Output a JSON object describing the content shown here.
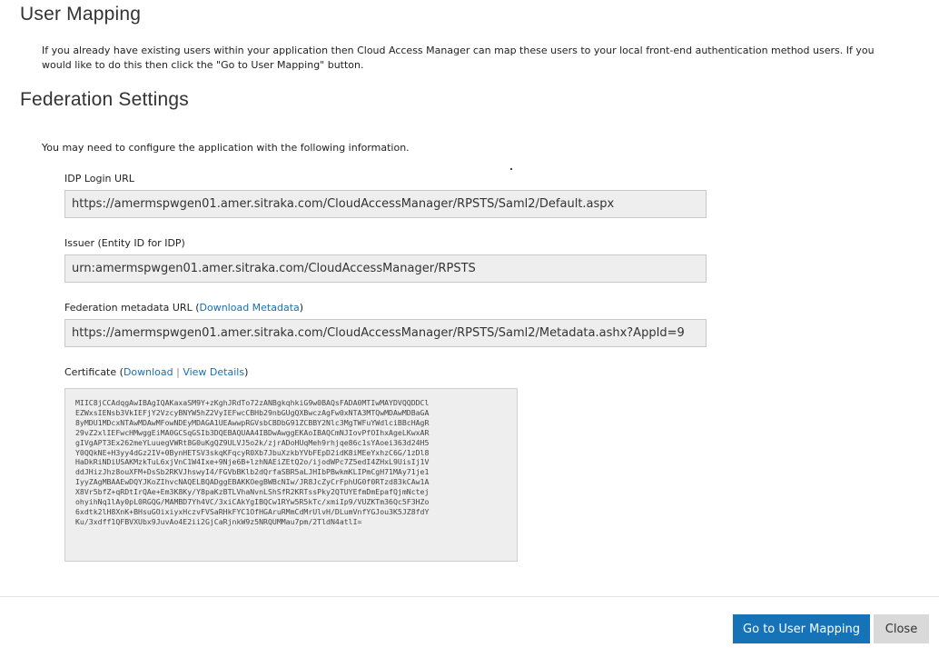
{
  "user_mapping": {
    "heading": "User Mapping",
    "description": "If you already have existing users within your application then Cloud Access Manager can map these users to your local front-end authentication method users. If you would like to do this then click the \"Go to User Mapping\" button."
  },
  "federation": {
    "heading": "Federation Settings",
    "intro": "You may need to configure the application with the following information.",
    "idp_login_url": {
      "label": "IDP Login URL",
      "value": "https://amermspwgen01.amer.sitraka.com/CloudAccessManager/RPSTS/Saml2/Default.aspx"
    },
    "issuer": {
      "label": "Issuer (Entity ID for IDP)",
      "value": "urn:amermspwgen01.amer.sitraka.com/CloudAccessManager/RPSTS"
    },
    "metadata": {
      "label_prefix": "Federation metadata URL (",
      "download_link": "Download Metadata",
      "label_suffix": ")",
      "value": "https://amermspwgen01.amer.sitraka.com/CloudAccessManager/RPSTS/Saml2/Metadata.ashx?AppId=9"
    },
    "certificate": {
      "label_prefix": "Certificate (",
      "download_link": "Download",
      "separator": " | ",
      "view_link": "View Details",
      "label_suffix": ")",
      "lines": [
        "MIIC8jCCAdqgAwIBAgIQAKaxaSM9Y+zKghJRdTo72zANBgkqhkiG9w0BAQsFADA0MTIwMAYDVQQDDCl",
        "EZWxsIENsb3VkIEFjY2VzcyBNYW5hZ2VyIEFwcCBHb29nbGUgQXBwczAgFw0xNTA3MTQwMDAwMDBaGA",
        "8yMDU1MDcxNTAwMDAwMFowNDEyMDAGA1UEAwwpRGVsbCBDbG91ZCBBY2Nlc3MgTWFuYWdlciBBcHAgR",
        "29vZ2xlIEFwcHMwggEiMA0GCSqGSIb3DQEBAQUAA4IBDwAwggEKAoIBAQCmNJIovPfOIhxAgeLKwxAR",
        "gIVgAPT3Ex262meYLuuegVWRt8G0uKgQZ9ULVJ5o2k/zjrADoHUqMeh9rhjqe86c1sYAoei363d24H5",
        "Y0QQkNE+H3yy4dGz2IV+0BynHETSV3skqKFqcyR0Xb7JbuXzkbYVbFEpD2idK8iMEeYxhzC6G/1zDl8",
        "HaDkRiNDiUSAKMzkTuL6xjVnC1W4Ixe+9Nje6B+lzhNAEiZEtQ2o/ijodWPc7Z5edI4ZHxL9UisIj1V",
        "ddJHizJhz8ouXFM+DsSb2RKVJhswyI4/FGVbBKlb2dQrfaSBR5aLJHIbPBwkmKLIPmCgH71MAy71je1",
        "IyyZAgMBAAEwDQYJKoZIhvcNAQELBQADggEBAKKOegBWBcNIw/JR8JcZyCrFphUG0f0RTzd83kCAw1A",
        "X8Vr5bfZ+qRDtIrQAe+Em3K8Ky/Y8paKzBTLVhaNvnLShSfR2KRTssPky2QTUYEfmDmEpafQjmNctej",
        "ohyihNq1lAy0pL0RGQG/MAMBD7Yh4VC/3xiCAkYgIBQCw1RYw5R5kTc/xmiIp9/VUZKTm36Qc5F3HZo",
        "6xdtk2lH8XnK+BHsuGOixiyxHczvFVSaRHkFYC1OfHGAruRMmCdMrUlvH/DLumVnfYGJou3K5JZ8fdY",
        "Ku/3xdff1QFBVXUbx9JuvAo4E2ii2GjCaRjnkW9z5NRQUMMau7pm/2TldN4atlI="
      ]
    }
  },
  "footer": {
    "primary_button": "Go to User Mapping",
    "secondary_button": "Close"
  }
}
